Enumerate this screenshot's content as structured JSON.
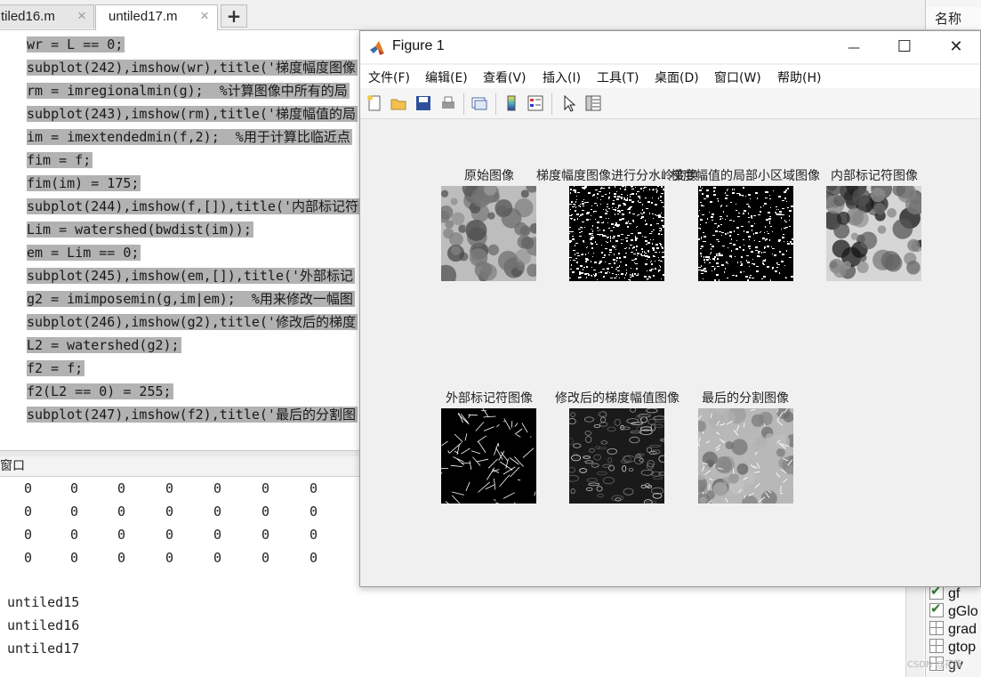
{
  "editor": {
    "tabs": [
      {
        "label": "tiled16.m"
      },
      {
        "label": "untiled17.m"
      }
    ],
    "close_glyph": "×",
    "add_glyph": "+",
    "lines": [
      "wr = L == 0;",
      "subplot(242),imshow(wr),title('梯度幅度图像",
      "rm = imregionalmin(g);  %计算图像中所有的局",
      "subplot(243),imshow(rm),title('梯度幅值的局",
      "im = imextendedmin(f,2);  %用于计算比临近点",
      "fim = f;",
      "fim(im) = 175;",
      "subplot(244),imshow(f,[]),title('内部标记符",
      "Lim = watershed(bwdist(im));",
      "em = Lim == 0;",
      "subplot(245),imshow(em,[]),title('外部标记",
      "g2 = imimposemin(g,im|em);  %用来修改一幅图",
      "subplot(246),imshow(g2),title('修改后的梯度",
      "L2 = watershed(g2);",
      "f2 = f;",
      "f2(L2 == 0) = 255;",
      "subplot(247),imshow(f2),title('最后的分割图"
    ]
  },
  "command_window": {
    "title": "窗口",
    "matrix": [
      [
        "0",
        "0",
        "0",
        "0",
        "0",
        "0",
        "0"
      ],
      [
        "0",
        "0",
        "0",
        "0",
        "0",
        "0",
        "0"
      ],
      [
        "0",
        "0",
        "0",
        "0",
        "0",
        "0",
        "0"
      ],
      [
        "0",
        "0",
        "0",
        "0",
        "0",
        "0",
        "0"
      ]
    ],
    "history": [
      "untiled15",
      "untiled16",
      "untiled17"
    ]
  },
  "workspace": {
    "header": "名称",
    "vars": [
      {
        "name": "gf",
        "icon": "check-icon"
      },
      {
        "name": "gGlo",
        "icon": "check-icon"
      },
      {
        "name": "grad",
        "icon": "grid-icon"
      },
      {
        "name": "gtop",
        "icon": "grid-icon"
      },
      {
        "name": "gv",
        "icon": "grid-icon"
      }
    ]
  },
  "watermark": "CSDN @花落",
  "figure": {
    "title": "Figure 1",
    "window_buttons": {
      "minimize": "—",
      "maximize": "☐",
      "close": "✕"
    },
    "menus": [
      "文件(F)",
      "编辑(E)",
      "查看(V)",
      "插入(I)",
      "工具(T)",
      "桌面(D)",
      "窗口(W)",
      "帮助(H)"
    ],
    "toolbar": [
      "new-figure-icon",
      "open-file-icon",
      "save-icon",
      "print-icon",
      "link-axes-icon",
      "colorbar-icon",
      "legend-icon",
      "select-arrow-icon",
      "property-inspector-icon"
    ],
    "subplots": [
      {
        "title": "原始图像",
        "kind": "blob-gray"
      },
      {
        "title": "梯度幅度图像进行分水岭变换",
        "kind": "noise-bw"
      },
      {
        "title": "梯度幅值的局部小区域图像",
        "kind": "noise-black"
      },
      {
        "title": "内部标记符图像",
        "kind": "blob-contrast"
      },
      {
        "title": "外部标记符图像",
        "kind": "cells"
      },
      {
        "title": "修改后的梯度幅值图像",
        "kind": "dark-texture"
      },
      {
        "title": "最后的分割图像",
        "kind": "segmented"
      }
    ],
    "accent": "#e87722"
  }
}
